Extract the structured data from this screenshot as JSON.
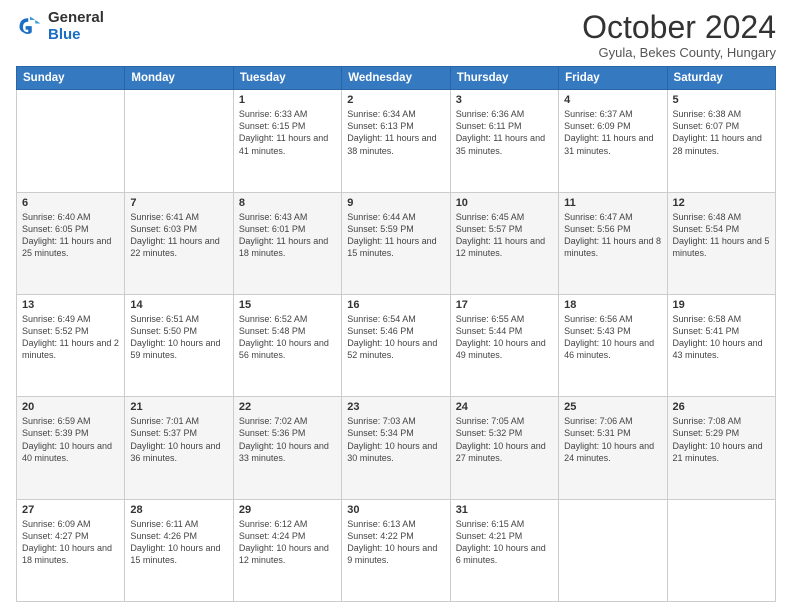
{
  "header": {
    "logo_general": "General",
    "logo_blue": "Blue",
    "month": "October 2024",
    "location": "Gyula, Bekes County, Hungary"
  },
  "weekdays": [
    "Sunday",
    "Monday",
    "Tuesday",
    "Wednesday",
    "Thursday",
    "Friday",
    "Saturday"
  ],
  "weeks": [
    [
      {
        "day": "",
        "info": ""
      },
      {
        "day": "",
        "info": ""
      },
      {
        "day": "1",
        "info": "Sunrise: 6:33 AM\nSunset: 6:15 PM\nDaylight: 11 hours and 41 minutes."
      },
      {
        "day": "2",
        "info": "Sunrise: 6:34 AM\nSunset: 6:13 PM\nDaylight: 11 hours and 38 minutes."
      },
      {
        "day": "3",
        "info": "Sunrise: 6:36 AM\nSunset: 6:11 PM\nDaylight: 11 hours and 35 minutes."
      },
      {
        "day": "4",
        "info": "Sunrise: 6:37 AM\nSunset: 6:09 PM\nDaylight: 11 hours and 31 minutes."
      },
      {
        "day": "5",
        "info": "Sunrise: 6:38 AM\nSunset: 6:07 PM\nDaylight: 11 hours and 28 minutes."
      }
    ],
    [
      {
        "day": "6",
        "info": "Sunrise: 6:40 AM\nSunset: 6:05 PM\nDaylight: 11 hours and 25 minutes."
      },
      {
        "day": "7",
        "info": "Sunrise: 6:41 AM\nSunset: 6:03 PM\nDaylight: 11 hours and 22 minutes."
      },
      {
        "day": "8",
        "info": "Sunrise: 6:43 AM\nSunset: 6:01 PM\nDaylight: 11 hours and 18 minutes."
      },
      {
        "day": "9",
        "info": "Sunrise: 6:44 AM\nSunset: 5:59 PM\nDaylight: 11 hours and 15 minutes."
      },
      {
        "day": "10",
        "info": "Sunrise: 6:45 AM\nSunset: 5:57 PM\nDaylight: 11 hours and 12 minutes."
      },
      {
        "day": "11",
        "info": "Sunrise: 6:47 AM\nSunset: 5:56 PM\nDaylight: 11 hours and 8 minutes."
      },
      {
        "day": "12",
        "info": "Sunrise: 6:48 AM\nSunset: 5:54 PM\nDaylight: 11 hours and 5 minutes."
      }
    ],
    [
      {
        "day": "13",
        "info": "Sunrise: 6:49 AM\nSunset: 5:52 PM\nDaylight: 11 hours and 2 minutes."
      },
      {
        "day": "14",
        "info": "Sunrise: 6:51 AM\nSunset: 5:50 PM\nDaylight: 10 hours and 59 minutes."
      },
      {
        "day": "15",
        "info": "Sunrise: 6:52 AM\nSunset: 5:48 PM\nDaylight: 10 hours and 56 minutes."
      },
      {
        "day": "16",
        "info": "Sunrise: 6:54 AM\nSunset: 5:46 PM\nDaylight: 10 hours and 52 minutes."
      },
      {
        "day": "17",
        "info": "Sunrise: 6:55 AM\nSunset: 5:44 PM\nDaylight: 10 hours and 49 minutes."
      },
      {
        "day": "18",
        "info": "Sunrise: 6:56 AM\nSunset: 5:43 PM\nDaylight: 10 hours and 46 minutes."
      },
      {
        "day": "19",
        "info": "Sunrise: 6:58 AM\nSunset: 5:41 PM\nDaylight: 10 hours and 43 minutes."
      }
    ],
    [
      {
        "day": "20",
        "info": "Sunrise: 6:59 AM\nSunset: 5:39 PM\nDaylight: 10 hours and 40 minutes."
      },
      {
        "day": "21",
        "info": "Sunrise: 7:01 AM\nSunset: 5:37 PM\nDaylight: 10 hours and 36 minutes."
      },
      {
        "day": "22",
        "info": "Sunrise: 7:02 AM\nSunset: 5:36 PM\nDaylight: 10 hours and 33 minutes."
      },
      {
        "day": "23",
        "info": "Sunrise: 7:03 AM\nSunset: 5:34 PM\nDaylight: 10 hours and 30 minutes."
      },
      {
        "day": "24",
        "info": "Sunrise: 7:05 AM\nSunset: 5:32 PM\nDaylight: 10 hours and 27 minutes."
      },
      {
        "day": "25",
        "info": "Sunrise: 7:06 AM\nSunset: 5:31 PM\nDaylight: 10 hours and 24 minutes."
      },
      {
        "day": "26",
        "info": "Sunrise: 7:08 AM\nSunset: 5:29 PM\nDaylight: 10 hours and 21 minutes."
      }
    ],
    [
      {
        "day": "27",
        "info": "Sunrise: 6:09 AM\nSunset: 4:27 PM\nDaylight: 10 hours and 18 minutes."
      },
      {
        "day": "28",
        "info": "Sunrise: 6:11 AM\nSunset: 4:26 PM\nDaylight: 10 hours and 15 minutes."
      },
      {
        "day": "29",
        "info": "Sunrise: 6:12 AM\nSunset: 4:24 PM\nDaylight: 10 hours and 12 minutes."
      },
      {
        "day": "30",
        "info": "Sunrise: 6:13 AM\nSunset: 4:22 PM\nDaylight: 10 hours and 9 minutes."
      },
      {
        "day": "31",
        "info": "Sunrise: 6:15 AM\nSunset: 4:21 PM\nDaylight: 10 hours and 6 minutes."
      },
      {
        "day": "",
        "info": ""
      },
      {
        "day": "",
        "info": ""
      }
    ]
  ]
}
